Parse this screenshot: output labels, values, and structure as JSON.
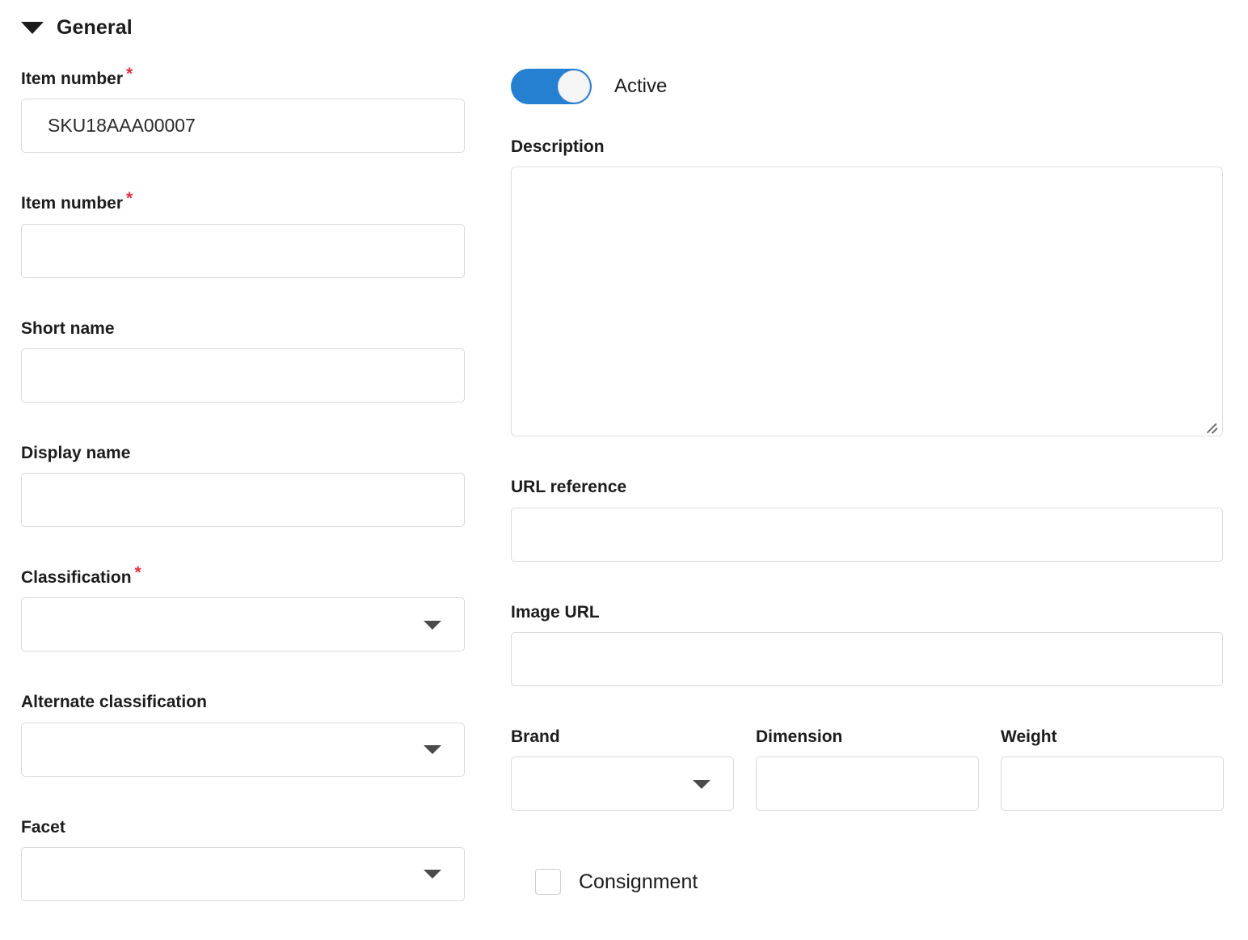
{
  "section": {
    "title": "General",
    "expanded": true,
    "collapse_icon": "triangle-down-icon"
  },
  "colors": {
    "accent": "#2680d2",
    "required_asterisk": "#e03242",
    "border": "#d9d9d9",
    "text": "#1c1c1c",
    "background": "#ffffff"
  },
  "left_column": {
    "fields": [
      {
        "label": "Item number",
        "required": true,
        "required_marker": "*",
        "type": "text",
        "value": "SKU18AAA00007",
        "placeholder": ""
      },
      {
        "label": "Item number",
        "required": true,
        "required_marker": "*",
        "type": "text",
        "value": "",
        "placeholder": ""
      },
      {
        "label": "Short name",
        "required": false,
        "required_marker": "",
        "type": "text",
        "value": "",
        "placeholder": ""
      },
      {
        "label": "Display name",
        "required": false,
        "required_marker": "",
        "type": "text",
        "value": "",
        "placeholder": ""
      },
      {
        "label": "Classification",
        "required": true,
        "required_marker": "*",
        "type": "select",
        "value": "",
        "placeholder": ""
      },
      {
        "label": "Alternate classification",
        "required": false,
        "required_marker": "",
        "type": "select",
        "value": "",
        "placeholder": ""
      },
      {
        "label": "Facet",
        "required": false,
        "required_marker": "",
        "type": "select",
        "value": "",
        "placeholder": ""
      }
    ]
  },
  "right_column": {
    "active_toggle": {
      "label": "Active",
      "checked": true
    },
    "description": {
      "label": "Description",
      "value": "",
      "placeholder": "",
      "resize_handle": "resize-grip-icon"
    },
    "url_reference": {
      "label": "URL reference",
      "value": "",
      "placeholder": ""
    },
    "image_url": {
      "label": "Image URL",
      "value": "",
      "placeholder": ""
    },
    "triple": [
      {
        "label": "Brand",
        "type": "select",
        "value": "",
        "placeholder": ""
      },
      {
        "label": "Dimension",
        "type": "text",
        "value": "",
        "placeholder": ""
      },
      {
        "label": "Weight",
        "type": "text",
        "value": "",
        "placeholder": ""
      }
    ],
    "consignment": {
      "label": "Consignment",
      "checked": false
    }
  }
}
